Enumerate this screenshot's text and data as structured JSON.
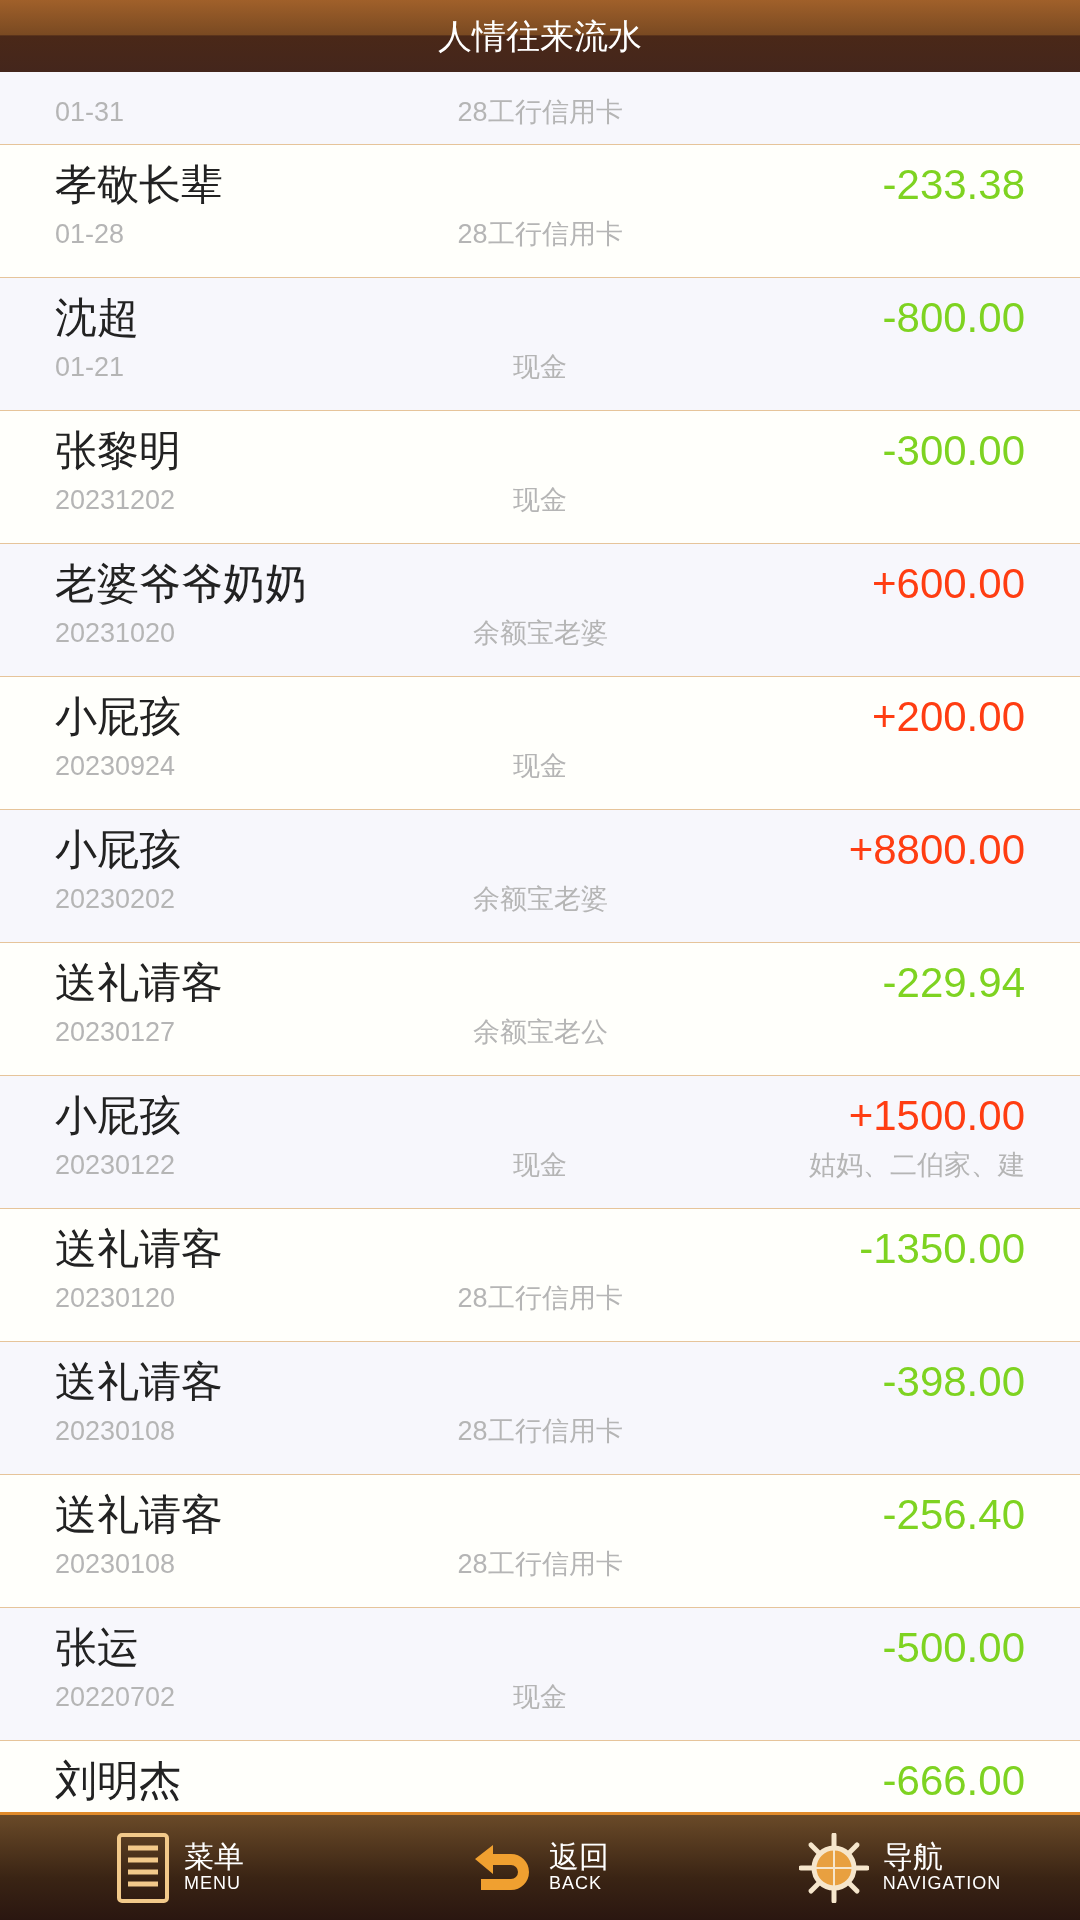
{
  "header": {
    "title": "人情往来流水"
  },
  "partial_top_row": {
    "date": "01-31",
    "account": "28工行信用卡"
  },
  "rows": [
    {
      "name": "孝敬长辈",
      "date": "01-28",
      "account": "28工行信用卡",
      "amount": "-233.38",
      "kind": "expense"
    },
    {
      "name": "沈超",
      "date": "01-21",
      "account": "现金",
      "amount": "-800.00",
      "kind": "expense"
    },
    {
      "name": "张黎明",
      "date": "20231202",
      "account": "现金",
      "amount": "-300.00",
      "kind": "expense"
    },
    {
      "name": "老婆爷爷奶奶",
      "date": "20231020",
      "account": "余额宝老婆",
      "amount": "+600.00",
      "kind": "income"
    },
    {
      "name": "小屁孩",
      "date": "20230924",
      "account": "现金",
      "amount": "+200.00",
      "kind": "income"
    },
    {
      "name": "小屁孩",
      "date": "20230202",
      "account": "余额宝老婆",
      "amount": "+8800.00",
      "kind": "income"
    },
    {
      "name": "送礼请客",
      "date": "20230127",
      "account": "余额宝老公",
      "amount": "-229.94",
      "kind": "expense"
    },
    {
      "name": "小屁孩",
      "date": "20230122",
      "account": "现金",
      "amount": "+1500.00",
      "kind": "income",
      "note": "姑妈、二伯家、建"
    },
    {
      "name": "送礼请客",
      "date": "20230120",
      "account": "28工行信用卡",
      "amount": "-1350.00",
      "kind": "expense"
    },
    {
      "name": "送礼请客",
      "date": "20230108",
      "account": "28工行信用卡",
      "amount": "-398.00",
      "kind": "expense"
    },
    {
      "name": "送礼请客",
      "date": "20230108",
      "account": "28工行信用卡",
      "amount": "-256.40",
      "kind": "expense"
    },
    {
      "name": "张运",
      "date": "20220702",
      "account": "现金",
      "amount": "-500.00",
      "kind": "expense"
    }
  ],
  "partial_bottom_row": {
    "name": "刘明杰",
    "amount": "-666.00",
    "kind": "expense"
  },
  "bottom_bar": [
    {
      "kind": "menu",
      "label": "菜单",
      "sublabel": "MENU"
    },
    {
      "kind": "back",
      "label": "返回",
      "sublabel": "BACK"
    },
    {
      "kind": "navigation",
      "label": "导航",
      "sublabel": "NAVIGATION"
    }
  ]
}
